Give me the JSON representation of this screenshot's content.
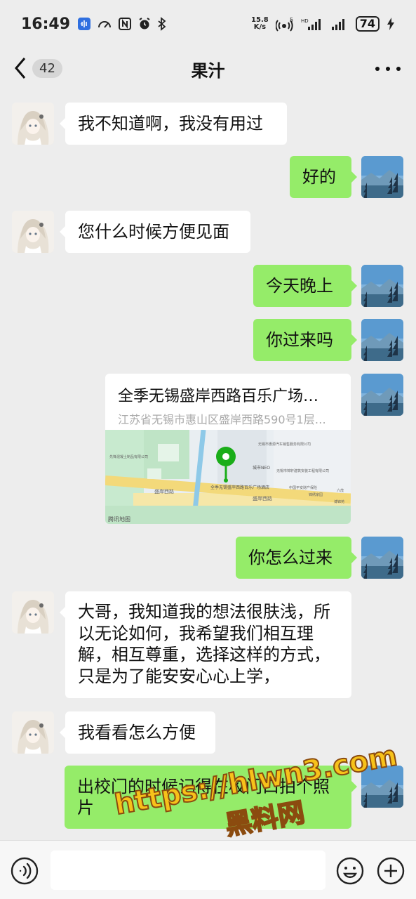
{
  "status_bar": {
    "time": "16:49",
    "net_speed_value": "15.8",
    "net_speed_unit": "K/s",
    "battery": "74"
  },
  "header": {
    "unread_count": "42",
    "title": "果汁"
  },
  "messages": [
    {
      "side": "left",
      "text": "我不知道啊，我没有用过"
    },
    {
      "side": "right",
      "text": "好的"
    },
    {
      "side": "left",
      "text": "您什么时候方便见面"
    },
    {
      "side": "right",
      "text": "今天晚上"
    },
    {
      "side": "right",
      "text": "你过来吗"
    },
    {
      "side": "right",
      "type": "location"
    },
    {
      "side": "right",
      "text": "你怎么过来"
    },
    {
      "side": "left",
      "text": "大哥，我知道我的想法很肤浅，所以无论如何，我希望我们相互理解，相互尊重，选择这样的方式，只是为了能安安心心上学，"
    },
    {
      "side": "left",
      "text": "我看看怎么方便"
    },
    {
      "side": "right",
      "text": "出校门的时候记得在校门口拍个照片"
    }
  ],
  "location": {
    "title": "全季无锡盛岸西路百乐广场…",
    "address": "江苏省无锡市惠山区盛岸西路590号1层…",
    "map_labels": {
      "road_name": "盛岸西路",
      "road_name_2": "盛岸西路",
      "map_provider": "腾讯地图",
      "pin_label": "全季无锡盛岸西路百乐广场酒店",
      "neo": "城市NEO",
      "poi_1": "无锡市惠源汽车销售服务有限公司",
      "poi_2": "先锋混凝土制品有限公司",
      "poi_3": "无锡市锦轩建筑安装工程有限公司",
      "poi_4": "中国平安财产保险",
      "poi_5": "锦绣家园",
      "poi_6": "博锦苑",
      "poi_7": "六茂"
    }
  },
  "watermark": {
    "line1": "https://hlwn3.com",
    "line2": "黑料网"
  },
  "colors": {
    "background": "#ededed",
    "bubble_right": "#95ec69",
    "bubble_left": "#ffffff",
    "map_pin": "#1aad19"
  },
  "icons": {
    "back": "chevron-left-icon",
    "more": "more-dots-icon",
    "voice": "voice-icon",
    "emoji": "emoji-icon",
    "plus": "plus-icon"
  }
}
